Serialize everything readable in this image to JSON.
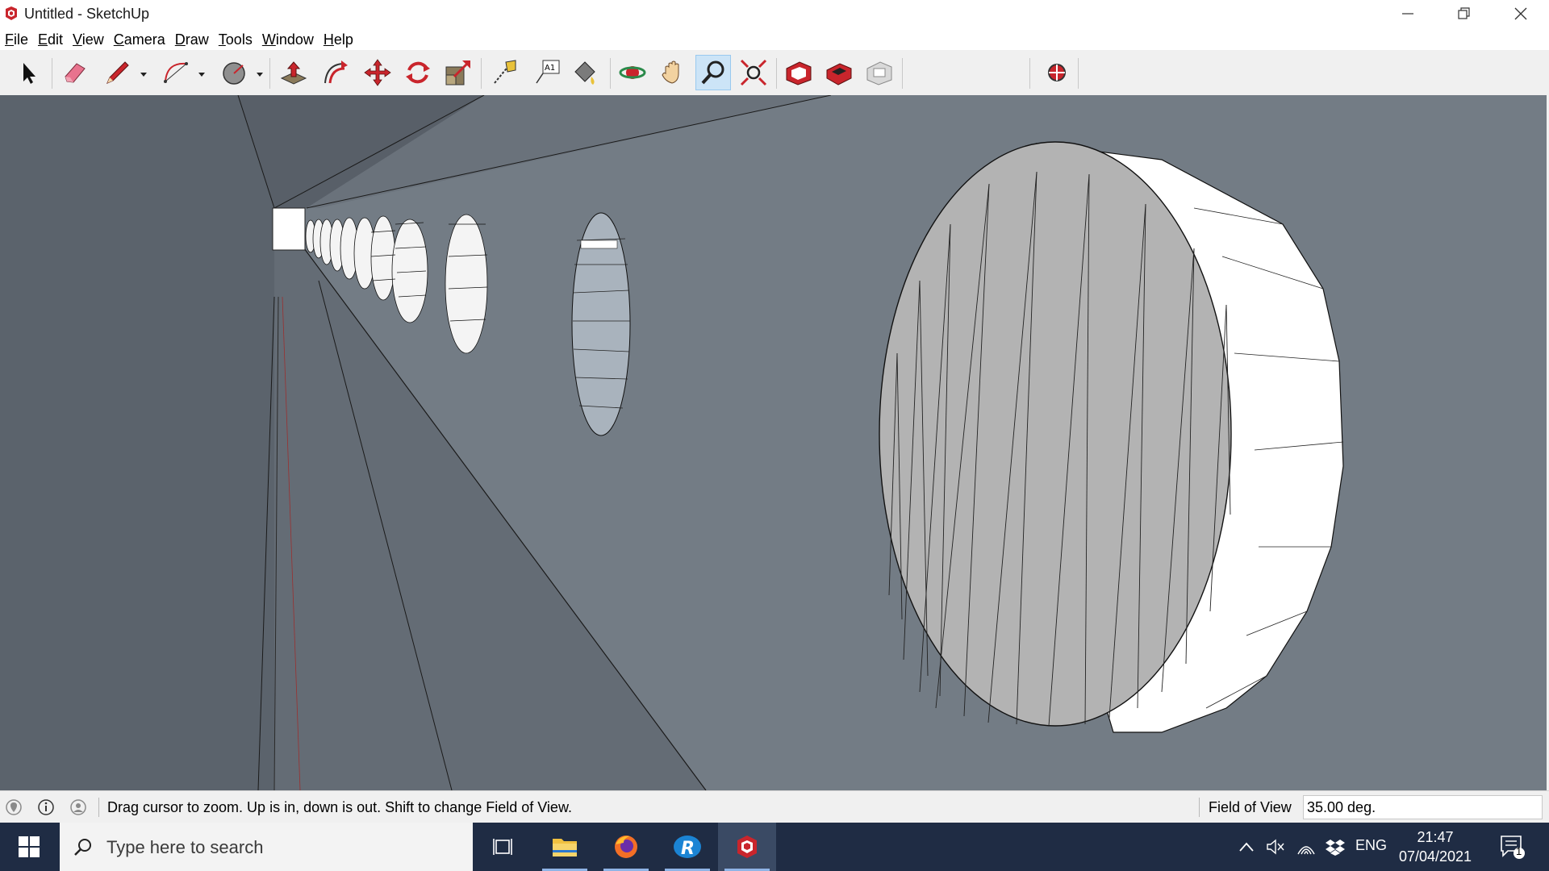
{
  "window": {
    "title": "Untitled - SketchUp"
  },
  "menu": [
    {
      "label": "File",
      "u": "F",
      "rest": "ile"
    },
    {
      "label": "Edit",
      "u": "E",
      "rest": "dit"
    },
    {
      "label": "View",
      "u": "V",
      "rest": "iew"
    },
    {
      "label": "Camera",
      "u": "C",
      "rest": "amera"
    },
    {
      "label": "Draw",
      "u": "D",
      "rest": "raw"
    },
    {
      "label": "Tools",
      "u": "T",
      "rest": "ools"
    },
    {
      "label": "Window",
      "u": "W",
      "rest": "indow"
    },
    {
      "label": "Help",
      "u": "H",
      "rest": "elp"
    }
  ],
  "toolbar": {
    "tools": [
      "select-tool",
      "eraser-tool",
      "line-tool",
      "arc-tool",
      "shapes-tool",
      "push-pull-tool",
      "offset-tool",
      "move-tool",
      "rotate-tool",
      "scale-tool",
      "tape-measure-tool",
      "text-tool",
      "paint-bucket-tool",
      "orbit-tool",
      "pan-tool",
      "zoom-tool",
      "zoom-extents-tool",
      "3d-warehouse-tool",
      "extension-warehouse-tool",
      "layout-tool",
      "extension-manager-tool"
    ],
    "active": "zoom-tool"
  },
  "status": {
    "hint": "Drag cursor to zoom.  Up is in, down is out. Shift to change Field of View.",
    "fov_label": "Field of View",
    "fov_value": "35.00 deg."
  },
  "taskbar": {
    "search_placeholder": "Type here to search",
    "language": "ENG",
    "time": "21:47",
    "date": "07/04/2021",
    "notification_count": "1"
  },
  "colors": {
    "viewport_bg": "#6e7780",
    "taskbar_bg": "#1f2c44",
    "toolbar_bg": "#f0f0f0",
    "sketchup_red": "#c9252c"
  }
}
